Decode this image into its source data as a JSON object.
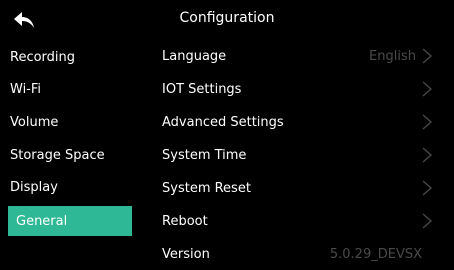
{
  "header": {
    "title": "Configuration",
    "back_icon": "back-arrow-icon"
  },
  "sidebar": {
    "items": [
      {
        "label": "Recording"
      },
      {
        "label": "Wi-Fi"
      },
      {
        "label": "Volume"
      },
      {
        "label": "Storage Space"
      },
      {
        "label": "Display"
      },
      {
        "label": "General",
        "active": true
      }
    ],
    "active_color": "#2fb896"
  },
  "settings": {
    "rows": [
      {
        "label": "Language",
        "value": "English",
        "chevron": true
      },
      {
        "label": "IOT Settings",
        "chevron": true
      },
      {
        "label": "Advanced Settings",
        "chevron": true
      },
      {
        "label": "System Time",
        "chevron": true
      },
      {
        "label": "System Reset",
        "chevron": true
      },
      {
        "label": "Reboot",
        "chevron": true
      }
    ],
    "version": {
      "label": "Version",
      "value": "5.0.29_DEVSX"
    }
  }
}
